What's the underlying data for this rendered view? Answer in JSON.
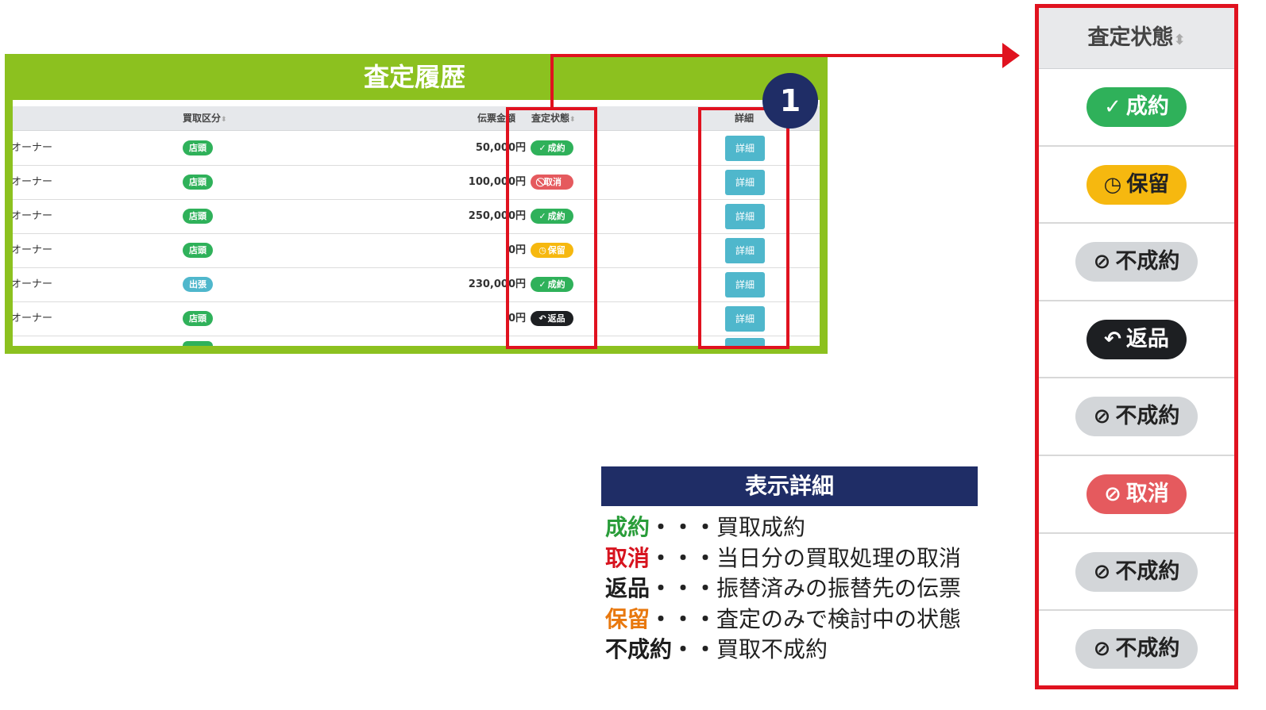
{
  "screenshot": {
    "title": "査定履歴",
    "columns": {
      "kubun": "買取区分",
      "kingaku": "伝票金額",
      "status": "査定状態",
      "detail": "詳細",
      "sort_icon": "⬍"
    },
    "rows": [
      {
        "owner": "オーナー",
        "kubun": "店頭",
        "kubun_color": "#2fb15a",
        "amount": "50,000円",
        "status": "成約",
        "status_icon": "✓",
        "status_color": "#2fb15a",
        "detail": "詳細"
      },
      {
        "owner": "オーナー",
        "kubun": "店頭",
        "kubun_color": "#2fb15a",
        "amount": "100,000円",
        "status": "取消",
        "status_icon": "⃠",
        "status_color": "#e55a5e",
        "detail": "詳細"
      },
      {
        "owner": "オーナー",
        "kubun": "店頭",
        "kubun_color": "#2fb15a",
        "amount": "250,000円",
        "status": "成約",
        "status_icon": "✓",
        "status_color": "#2fb15a",
        "detail": "詳細"
      },
      {
        "owner": "オーナー",
        "kubun": "店頭",
        "kubun_color": "#2fb15a",
        "amount": "0円",
        "status": "保留",
        "status_icon": "◷",
        "status_color": "#f6b80f",
        "detail": "詳細"
      },
      {
        "owner": "オーナー",
        "kubun": "出張",
        "kubun_color": "#4fb7cc",
        "amount": "230,000円",
        "status": "成約",
        "status_icon": "✓",
        "status_color": "#2fb15a",
        "detail": "詳細"
      },
      {
        "owner": "オーナー",
        "kubun": "店頭",
        "kubun_color": "#2fb15a",
        "amount": "0円",
        "status": "返品",
        "status_icon": "↶",
        "status_color": "#1d1f22",
        "detail": "詳細"
      }
    ],
    "callout_number": "1"
  },
  "legend": {
    "title": "表示詳細",
    "items": [
      {
        "term": "成約",
        "dots": "・・・",
        "desc": "買取成約",
        "color": "#2a9d3a"
      },
      {
        "term": "取消",
        "dots": "・・・",
        "desc": "当日分の買取処理の取消",
        "color": "#d7141f"
      },
      {
        "term": "返品",
        "dots": "・・・",
        "desc": "振替済みの振替先の伝票",
        "color": "#1d1d1d"
      },
      {
        "term": "保留",
        "dots": "・・・",
        "desc": "査定のみで検討中の状態",
        "color": "#e8780e"
      },
      {
        "term": "不成約",
        "dots": "・・",
        "desc": "買取不成約",
        "color": "#1d1d1d"
      }
    ]
  },
  "zoom": {
    "header": "査定状態",
    "sort_icon": "⬍",
    "statuses": [
      {
        "label": "成約",
        "icon": "✓",
        "bg": "#2fb15a",
        "fg": "#ffffff"
      },
      {
        "label": "保留",
        "icon": "◷",
        "bg": "#f6b80f",
        "fg": "#222222"
      },
      {
        "label": "不成約",
        "icon": "⊘",
        "bg": "#d3d6d9",
        "fg": "#222222"
      },
      {
        "label": "返品",
        "icon": "↶",
        "bg": "#1d1f22",
        "fg": "#ffffff"
      },
      {
        "label": "不成約",
        "icon": "⊘",
        "bg": "#d3d6d9",
        "fg": "#222222"
      },
      {
        "label": "取消",
        "icon": "⊘",
        "bg": "#e55a5e",
        "fg": "#ffffff"
      },
      {
        "label": "不成約",
        "icon": "⊘",
        "bg": "#d3d6d9",
        "fg": "#222222"
      },
      {
        "label": "不成約",
        "icon": "⊘",
        "bg": "#d3d6d9",
        "fg": "#222222"
      }
    ]
  }
}
